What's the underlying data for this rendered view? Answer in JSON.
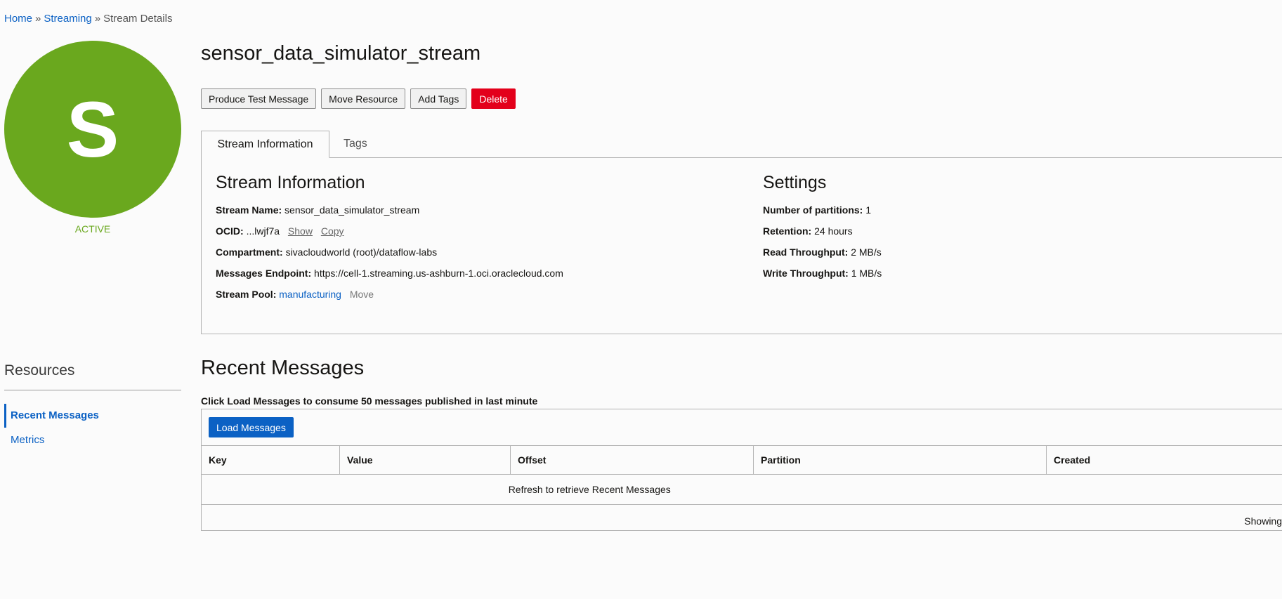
{
  "breadcrumb": {
    "home": "Home",
    "sep": "»",
    "streaming": "Streaming",
    "current": "Stream Details"
  },
  "avatar": {
    "letter": "S",
    "status": "ACTIVE"
  },
  "header": {
    "title": "sensor_data_simulator_stream"
  },
  "actions": {
    "produce": "Produce Test Message",
    "move": "Move Resource",
    "tags": "Add Tags",
    "delete": "Delete"
  },
  "tabs": {
    "info": "Stream Information",
    "tags": "Tags"
  },
  "stream_info": {
    "heading": "Stream Information",
    "name_label": "Stream Name:",
    "name_value": "sensor_data_simulator_stream",
    "ocid_label": "OCID:",
    "ocid_value": "...lwjf7a",
    "ocid_show": "Show",
    "ocid_copy": "Copy",
    "compartment_label": "Compartment:",
    "compartment_value": "sivacloudworld (root)/dataflow-labs",
    "endpoint_label": "Messages Endpoint:",
    "endpoint_value": "https://cell-1.streaming.us-ashburn-1.oci.oraclecloud.com",
    "pool_label": "Stream Pool:",
    "pool_value": "manufacturing",
    "pool_move": "Move"
  },
  "settings": {
    "heading": "Settings",
    "partitions_label": "Number of partitions:",
    "partitions_value": "1",
    "retention_label": "Retention:",
    "retention_value": "24 hours",
    "read_label": "Read Throughput:",
    "read_value": "2 MB/s",
    "write_label": "Write Throughput:",
    "write_value": "1 MB/s"
  },
  "resources": {
    "title": "Resources",
    "items": [
      {
        "label": "Recent Messages"
      },
      {
        "label": "Metrics"
      }
    ]
  },
  "recent": {
    "title": "Recent Messages",
    "hint": "Click Load Messages to consume 50 messages published in last minute",
    "load_button": "Load Messages",
    "columns": [
      "Key",
      "Value",
      "Offset",
      "Partition",
      "Created"
    ],
    "empty": "Refresh to retrieve Recent Messages",
    "showing": "Showing"
  },
  "colors": {
    "accent": "#0b61c4",
    "active_green": "#6aa81e",
    "danger": "#e3001b"
  }
}
